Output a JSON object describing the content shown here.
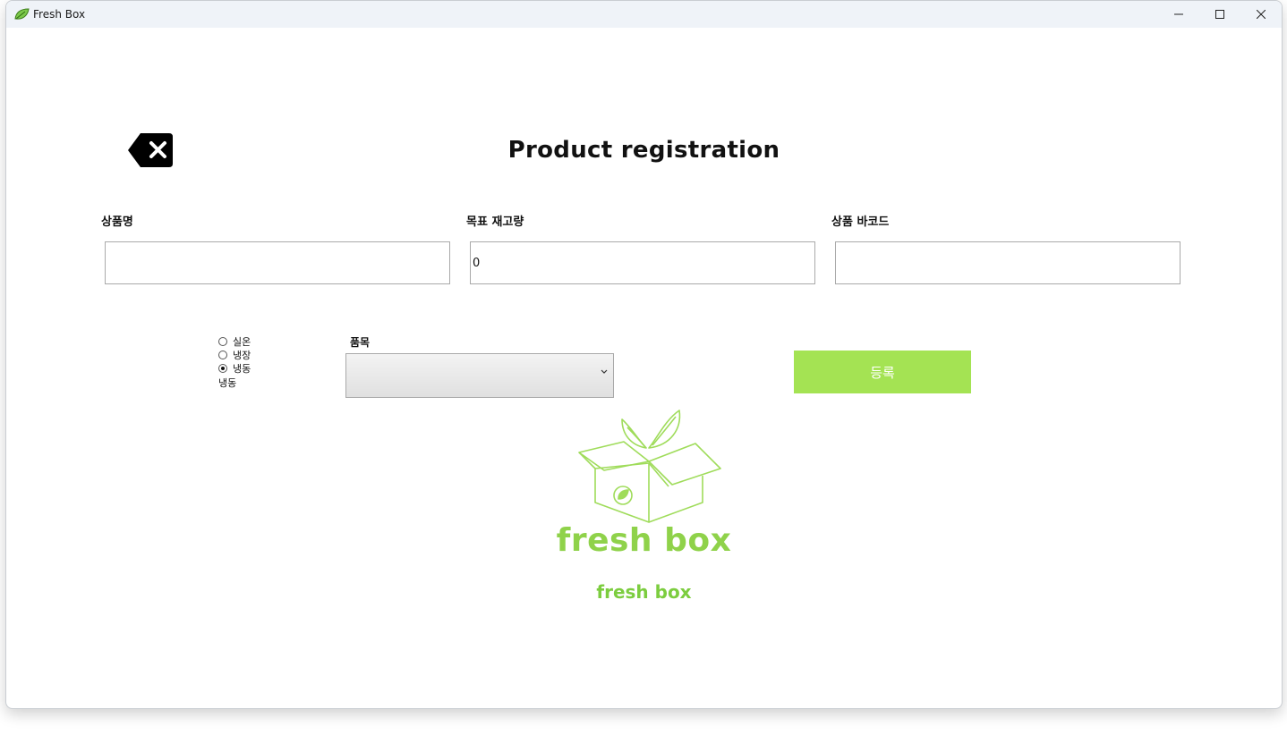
{
  "window": {
    "title": "Fresh Box",
    "app_icon": "leaf-icon",
    "controls": {
      "minimize": "minimize-icon",
      "maximize": "maximize-icon",
      "close": "close-icon"
    }
  },
  "header": {
    "back_icon": "backspace-icon",
    "title": "Product registration"
  },
  "form": {
    "product_name": {
      "label": "상품명",
      "value": ""
    },
    "target_stock": {
      "label": "목표 재고량",
      "value": "0"
    },
    "barcode": {
      "label": "상품 바코드",
      "value": ""
    }
  },
  "storage": {
    "options": [
      "실온",
      "냉장",
      "냉동"
    ],
    "selected_index": 2,
    "current_label": "냉동"
  },
  "category": {
    "label": "품목",
    "value": "",
    "arrow": "chevron-down-icon"
  },
  "register_button": {
    "label": "등록"
  },
  "logo": {
    "text": "fresh box",
    "subtitle": "fresh box",
    "icon": "box-with-leaves-icon"
  },
  "colors": {
    "accent_green": "#a4e353",
    "logo_green": "#8fd24a",
    "subtitle_green": "#7ccd3f"
  }
}
